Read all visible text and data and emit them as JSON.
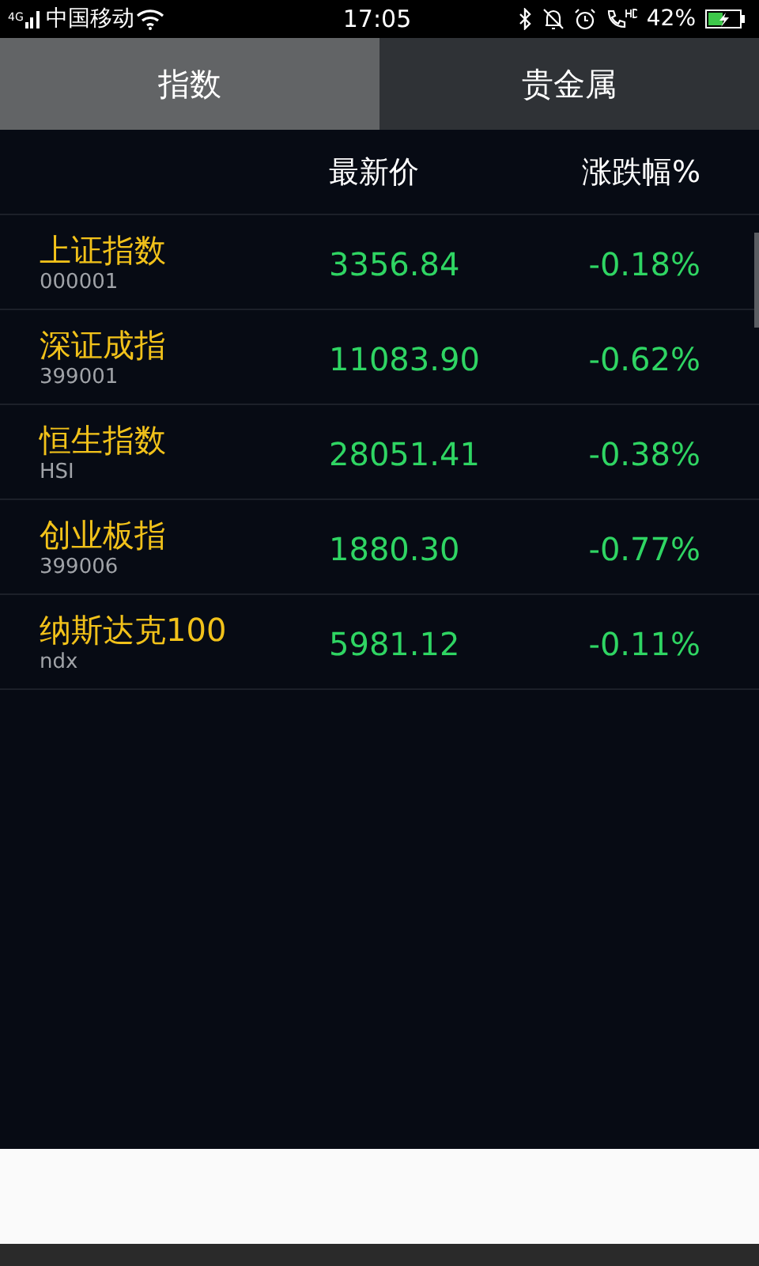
{
  "status_bar": {
    "carrier": "中国移动",
    "network": "4G",
    "time": "17:05",
    "battery": "42%",
    "charging": true
  },
  "tabs": [
    {
      "label": "指数",
      "selected": true
    },
    {
      "label": "贵金属",
      "selected": false
    }
  ],
  "table": {
    "columns": [
      "最新价",
      "涨跌幅%"
    ],
    "rows": [
      {
        "name": "上证指数",
        "code": "000001",
        "price": "3356.84",
        "change": "-0.18%"
      },
      {
        "name": "深证成指",
        "code": "399001",
        "price": "11083.90",
        "change": "-0.62%"
      },
      {
        "name": "恒生指数",
        "code": "HSI",
        "price": "28051.41",
        "change": "-0.38%"
      },
      {
        "name": "创业板指",
        "code": "399006",
        "price": "1880.30",
        "change": "-0.77%"
      },
      {
        "name": "纳斯达克100",
        "code": "ndx",
        "price": "5981.12",
        "change": "-0.11%"
      }
    ]
  }
}
